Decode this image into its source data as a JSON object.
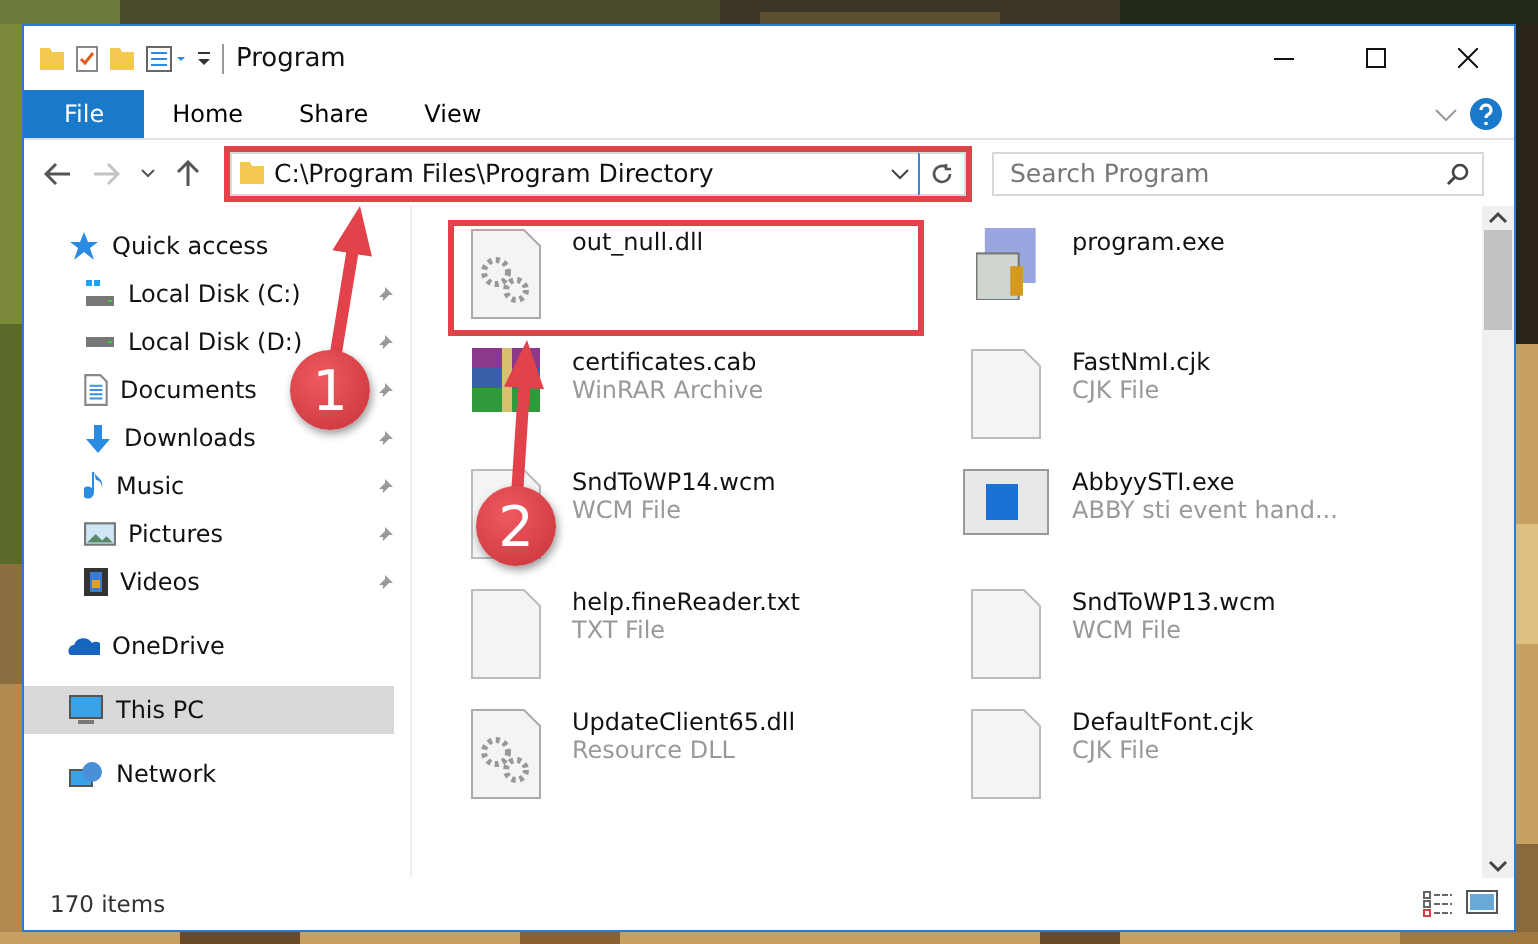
{
  "window": {
    "title": "Program"
  },
  "ribbon": {
    "tabs": [
      {
        "label": "File",
        "kind": "file",
        "selected": false
      },
      {
        "label": "Home",
        "kind": "tab",
        "selected": false
      },
      {
        "label": "Share",
        "kind": "tab",
        "selected": false
      },
      {
        "label": "View",
        "kind": "tab",
        "selected": false
      }
    ]
  },
  "navigation": {
    "forward_disabled": true
  },
  "address_bar": {
    "value": "C:\\Program Files\\Program Directory",
    "highlighted": true
  },
  "search": {
    "placeholder": "Search Program"
  },
  "sidebar": {
    "items": [
      {
        "label": "Quick access",
        "selected": false,
        "children": [
          {
            "label": "Local Disk (C:)",
            "pinned": true,
            "selected": false
          },
          {
            "label": "Local Disk (D:)",
            "pinned": true,
            "selected": false
          },
          {
            "label": "Documents",
            "pinned": true,
            "selected": false
          },
          {
            "label": "Downloads",
            "pinned": true,
            "selected": false
          },
          {
            "label": "Music",
            "pinned": true,
            "selected": false
          },
          {
            "label": "Pictures",
            "pinned": true,
            "selected": false
          },
          {
            "label": "Videos",
            "pinned": true,
            "selected": false
          }
        ]
      },
      {
        "label": "OneDrive",
        "selected": false
      },
      {
        "label": "This PC",
        "selected": true
      },
      {
        "label": "Network",
        "selected": false
      }
    ]
  },
  "files": [
    {
      "name": "out_null.dll",
      "highlighted": true
    },
    {
      "name": "program.exe",
      "highlighted": false
    },
    {
      "name": "certificates.cab",
      "type": "WinRAR Archive",
      "highlighted": false
    },
    {
      "name": "FastNmI.cjk",
      "type": "CJK File",
      "highlighted": false
    },
    {
      "name": "SndToWP14.wcm",
      "type": "WCM File",
      "highlighted": false
    },
    {
      "name": "AbbyySTI.exe",
      "type": "ABBY sti event hand...",
      "highlighted": false
    },
    {
      "name": "help.fineReader.txt",
      "type": "TXT File",
      "highlighted": false
    },
    {
      "name": "SndToWP13.wcm",
      "type": "WCM File",
      "highlighted": false
    },
    {
      "name": "UpdateClient65.dll",
      "type": "Resource DLL",
      "highlighted": false
    },
    {
      "name": "DefaultFont.cjk",
      "type": "CJK File",
      "highlighted": false
    }
  ],
  "status_bar": {
    "item_count": "170 items"
  },
  "annotations": [
    {
      "number": "1"
    },
    {
      "number": "2"
    }
  ]
}
